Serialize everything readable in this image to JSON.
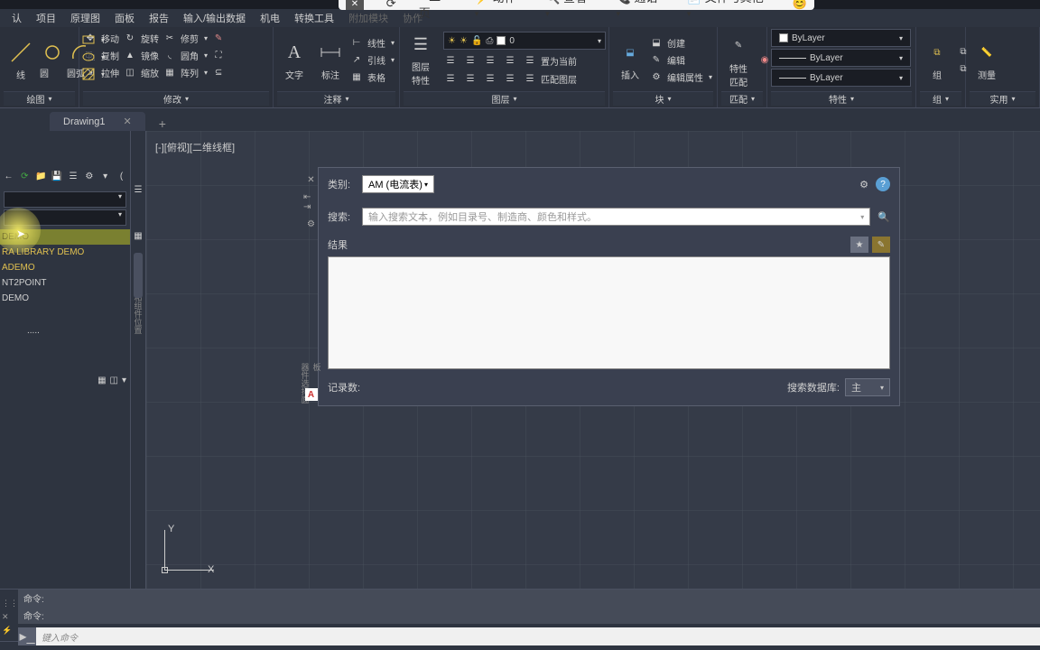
{
  "menus": [
    "认",
    "项目",
    "原理图",
    "面板",
    "报告",
    "输入/输出数据",
    "机电",
    "转换工具",
    "附加模块",
    "协作",
    "",
    "",
    "",
    "",
    "",
    ""
  ],
  "browser_top": {
    "close_x": "✕",
    "refresh": "⟳",
    "home": "主页",
    "action": "动作",
    "find": "查看",
    "call": "通话",
    "files": "文件与其他",
    "emoji": "😊"
  },
  "ribbon": {
    "draw": {
      "name": "绘图",
      "items": [
        "线",
        "圆",
        "圆弧"
      ]
    },
    "modify": {
      "name": "修改",
      "entries": [
        "移动",
        "旋转",
        "修剪",
        "复制",
        "镜像",
        "圆角",
        "拉伸",
        "缩放",
        "阵列"
      ]
    },
    "annot": {
      "name": "注释",
      "items": [
        "文字",
        "标注"
      ],
      "linear": "线性",
      "leader": "引线",
      "table": "表格"
    },
    "layer": {
      "name": "图层",
      "props": "图层\n特性",
      "current": "0",
      "setcurrent": "置为当前",
      "matchlayer": "匹配图层"
    },
    "insert": {
      "name": "块",
      "item": "插入",
      "create": "创建",
      "edit": "编辑",
      "attr": "编辑属性"
    },
    "match": {
      "name": "匹配",
      "item": "特性\n匹配"
    },
    "prop": {
      "name": "特性",
      "bylayer": "ByLayer"
    },
    "group": {
      "name": "组",
      "item": "组"
    },
    "meas": {
      "name": "测量",
      "item": "测量"
    },
    "util": {
      "name": "实用"
    }
  },
  "doc_tab": {
    "name": "Drawing1",
    "close": "✕"
  },
  "sidebar": {
    "items": [
      "DEMO",
      "RA LIBRARY DEMO",
      "ADEMO",
      "NT2POINT",
      "DEMO"
    ],
    "dots": "....."
  },
  "view_label": "[-][俯视][二维线框]",
  "panel": {
    "cat_label": "类别:",
    "cat_value": "AM (电流表)",
    "search_label": "搜索:",
    "search_placeholder": "输入搜索文本，例如目录号、制造商、颜色和样式。",
    "results": "结果",
    "rec_count": "记录数:",
    "db_label": "搜索数据库:",
    "db_value": "主"
  },
  "ucs": {
    "x": "X",
    "y": "Y"
  },
  "cmd": {
    "line1": "命令:",
    "line2": "命令:",
    "placeholder": "键入命令"
  }
}
